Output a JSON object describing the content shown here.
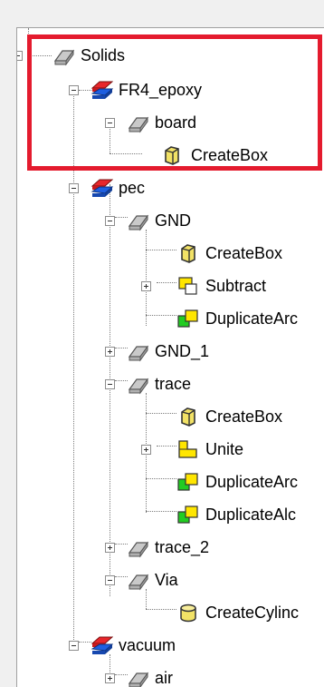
{
  "tree": {
    "root": {
      "label": "Solids",
      "icon": "solid-gray-icon"
    },
    "fr4": {
      "label": "FR4_epoxy",
      "icon": "material-icon"
    },
    "board": {
      "label": "board",
      "icon": "solid-gray-icon"
    },
    "board_createbox": {
      "label": "CreateBox",
      "icon": "create-box-icon"
    },
    "pec": {
      "label": "pec",
      "icon": "material-icon"
    },
    "gnd": {
      "label": "GND",
      "icon": "solid-gray-icon"
    },
    "gnd_createbox": {
      "label": "CreateBox",
      "icon": "create-box-icon"
    },
    "gnd_subtract": {
      "label": "Subtract",
      "icon": "subtract-icon"
    },
    "gnd_duplicate": {
      "label": "DuplicateArc",
      "icon": "duplicate-icon"
    },
    "gnd1": {
      "label": "GND_1",
      "icon": "solid-gray-icon"
    },
    "trace": {
      "label": "trace",
      "icon": "solid-gray-icon"
    },
    "trace_createbox": {
      "label": "CreateBox",
      "icon": "create-box-icon"
    },
    "trace_unite": {
      "label": "Unite",
      "icon": "unite-icon"
    },
    "trace_duplicate_arc": {
      "label": "DuplicateArc",
      "icon": "duplicate-icon"
    },
    "trace_duplicate_alc": {
      "label": "DuplicateAlc",
      "icon": "duplicate-icon"
    },
    "trace2": {
      "label": "trace_2",
      "icon": "solid-gray-icon"
    },
    "via": {
      "label": "Via",
      "icon": "solid-gray-icon"
    },
    "via_createcylinder": {
      "label": "CreateCylinc",
      "icon": "create-cylinder-icon"
    },
    "vacuum": {
      "label": "vacuum",
      "icon": "material-icon"
    },
    "air": {
      "label": "air",
      "icon": "solid-gray-icon"
    }
  },
  "colors": {
    "highlight": "#e41b2e",
    "material_red": "#e8262b",
    "material_blue": "#1f5fe0",
    "box_yellow": "#f2e266",
    "op_green": "#22cc22",
    "op_yellow": "#ffe600"
  }
}
